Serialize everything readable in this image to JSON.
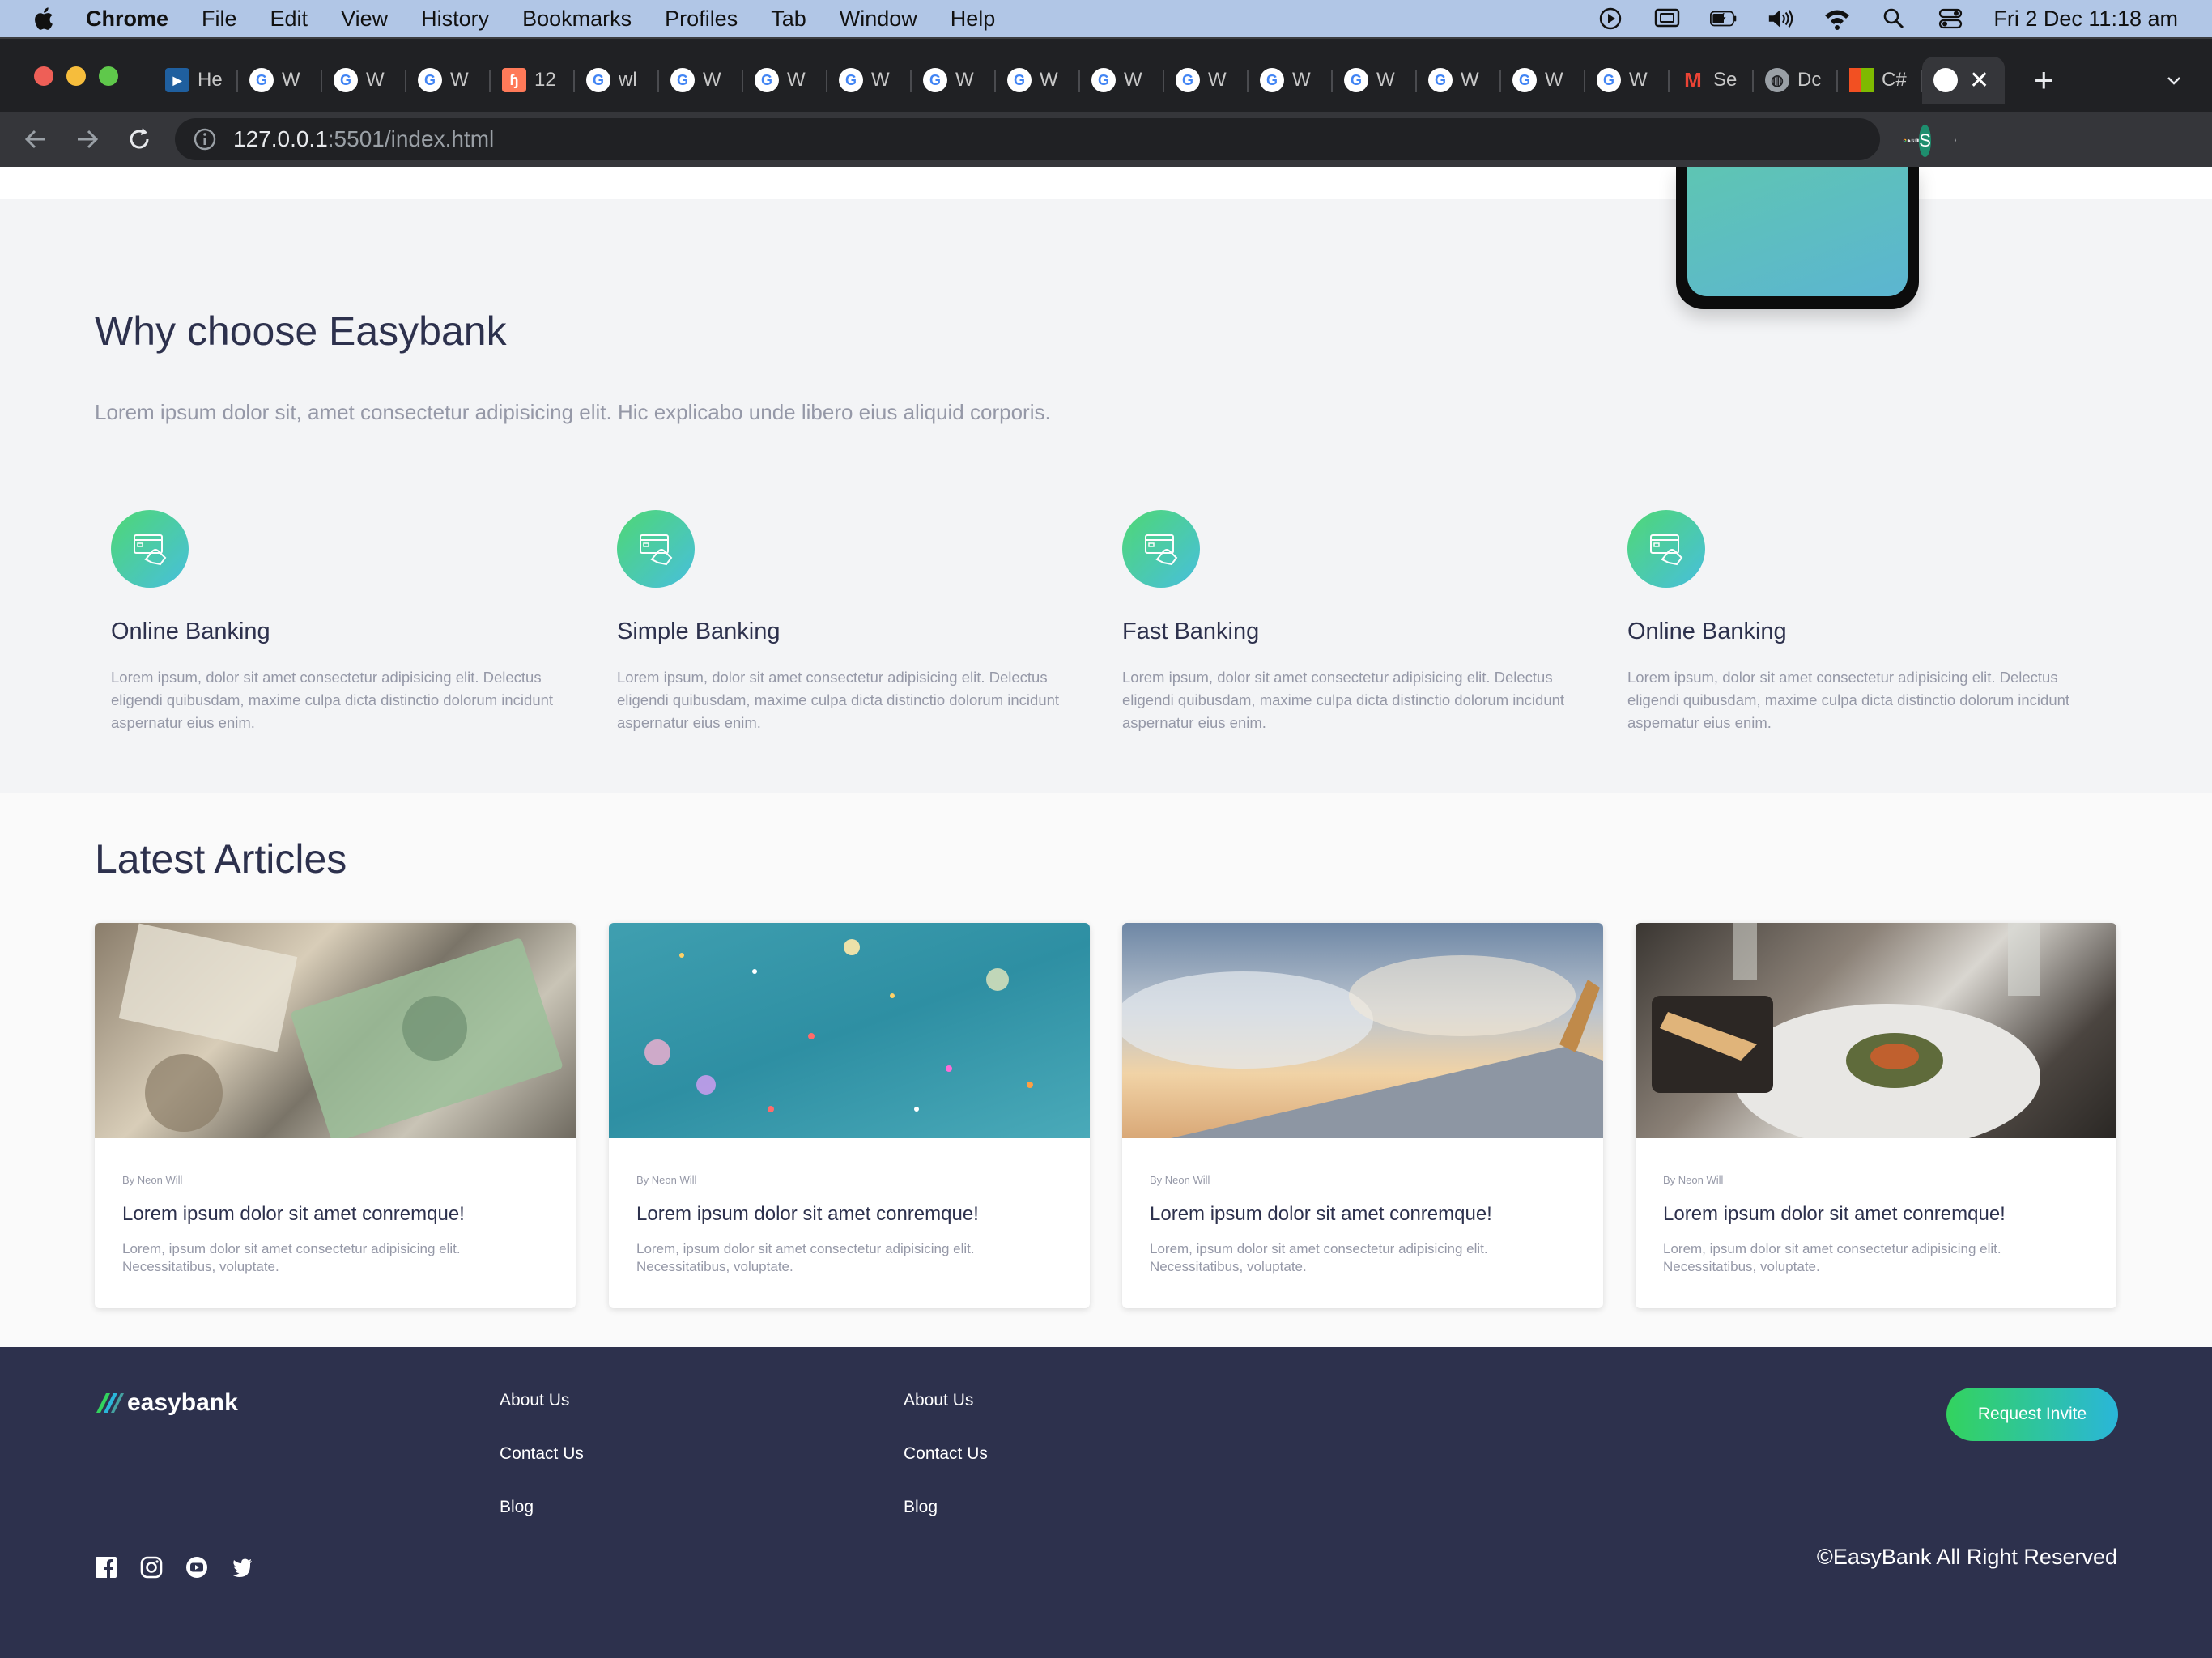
{
  "menubar": {
    "app_name": "Chrome",
    "menus": [
      "File",
      "Edit",
      "View",
      "History",
      "Bookmarks",
      "Profiles",
      "Tab",
      "Window",
      "Help"
    ],
    "clock": "Fri 2 Dec  11:18 am"
  },
  "tabs": [
    {
      "label": "He",
      "icon": "video-icon"
    },
    {
      "label": "W",
      "icon": "google-icon"
    },
    {
      "label": "W",
      "icon": "google-icon"
    },
    {
      "label": "W",
      "icon": "google-icon"
    },
    {
      "label": "12",
      "icon": "hubspot-icon"
    },
    {
      "label": "wl",
      "icon": "google-icon"
    },
    {
      "label": "W",
      "icon": "google-icon"
    },
    {
      "label": "W",
      "icon": "google-icon"
    },
    {
      "label": "W",
      "icon": "google-icon"
    },
    {
      "label": "W",
      "icon": "google-icon"
    },
    {
      "label": "W",
      "icon": "google-icon"
    },
    {
      "label": "W",
      "icon": "google-icon"
    },
    {
      "label": "W",
      "icon": "google-icon"
    },
    {
      "label": "W",
      "icon": "google-icon"
    },
    {
      "label": "W",
      "icon": "google-icon"
    },
    {
      "label": "W",
      "icon": "google-icon"
    },
    {
      "label": "W",
      "icon": "google-icon"
    },
    {
      "label": "W",
      "icon": "google-icon"
    },
    {
      "label": "Se",
      "icon": "gmail-icon"
    },
    {
      "label": "Dc",
      "icon": "globe-icon"
    },
    {
      "label": "C#",
      "icon": "microsoft-icon"
    }
  ],
  "address": {
    "host": "127.0.0.1",
    "rest": ":5501/index.html"
  },
  "profile_initial": "S",
  "why": {
    "title": "Why choose Easybank",
    "subtitle": "Lorem ipsum dolor sit, amet consectetur adipisicing elit. Hic explicabo unde libero eius aliquid corporis.",
    "features": [
      {
        "title": "Online Banking",
        "text": "Lorem ipsum, dolor sit amet consectetur adipisicing elit. Delectus eligendi quibusdam, maxime culpa dicta distinctio dolorum incidunt aspernatur eius enim."
      },
      {
        "title": "Simple Banking",
        "text": "Lorem ipsum, dolor sit amet consectetur adipisicing elit. Delectus eligendi quibusdam, maxime culpa dicta distinctio dolorum incidunt aspernatur eius enim."
      },
      {
        "title": "Fast Banking",
        "text": "Lorem ipsum, dolor sit amet consectetur adipisicing elit. Delectus eligendi quibusdam, maxime culpa dicta distinctio dolorum incidunt aspernatur eius enim."
      },
      {
        "title": "Online Banking",
        "text": "Lorem ipsum, dolor sit amet consectetur adipisicing elit. Delectus eligendi quibusdam, maxime culpa dicta distinctio dolorum incidunt aspernatur eius enim."
      }
    ]
  },
  "articles": {
    "title": "Latest Articles",
    "items": [
      {
        "author": "By Neon Will",
        "title": "Lorem ipsum dolor sit amet conremque!",
        "text": "Lorem, ipsum dolor sit amet consectetur adipisicing elit. Necessitatibus, voluptate."
      },
      {
        "author": "By Neon Will",
        "title": "Lorem ipsum dolor sit amet conremque!",
        "text": "Lorem, ipsum dolor sit amet consectetur adipisicing elit. Necessitatibus, voluptate."
      },
      {
        "author": "By Neon Will",
        "title": "Lorem ipsum dolor sit amet conremque!",
        "text": "Lorem, ipsum dolor sit amet consectetur adipisicing elit. Necessitatibus, voluptate."
      },
      {
        "author": "By Neon Will",
        "title": "Lorem ipsum dolor sit amet conremque!",
        "text": "Lorem, ipsum dolor sit amet consectetur adipisicing elit. Necessitatibus, voluptate."
      }
    ]
  },
  "footer": {
    "logo": "easybank",
    "col1": [
      "About Us",
      "Contact Us",
      "Blog"
    ],
    "col2": [
      "About Us",
      "Contact Us",
      "Blog"
    ],
    "invite": "Request Invite",
    "social": [
      "facebook-icon",
      "instagram-icon",
      "youtube-icon",
      "twitter-icon"
    ],
    "copyright": "©EasyBank All Right Reserved"
  },
  "colors": {
    "navy": "#2d314d",
    "lime": "#33d35e",
    "cyan": "#2ab6d9",
    "gray_text": "#9598a7",
    "light_bg": "#f3f4f6"
  }
}
